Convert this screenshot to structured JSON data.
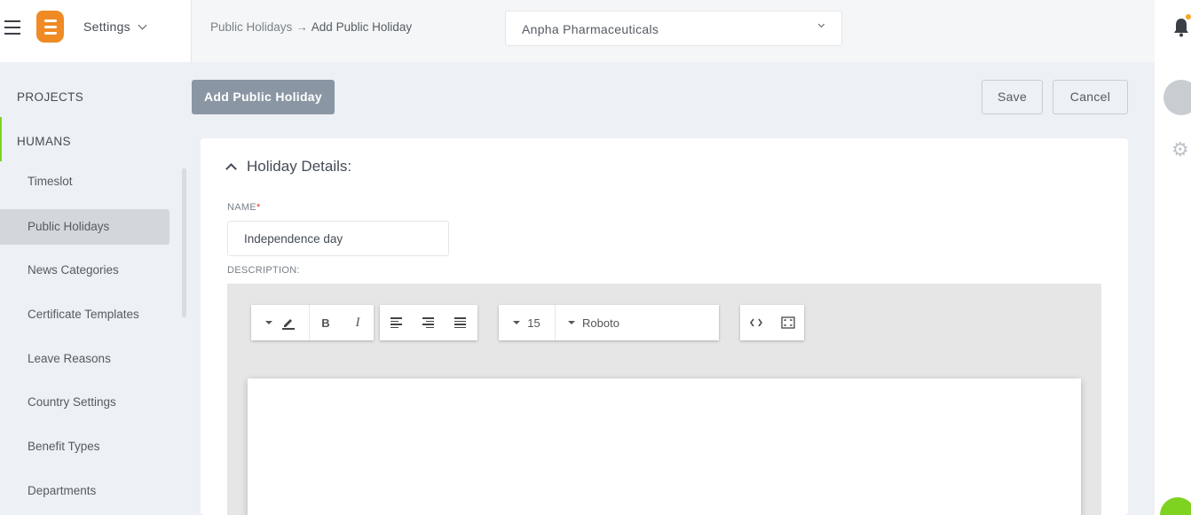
{
  "header": {
    "app_menu_label": "Settings",
    "breadcrumb": {
      "parent": "Public Holidays",
      "separator": "→",
      "current": "Add Public Holiday"
    },
    "organization": "Anpha Pharmaceuticals"
  },
  "sidebar": {
    "sections": [
      "PROJECTS",
      "HUMANS"
    ],
    "items": [
      {
        "label": "Timeslot"
      },
      {
        "label": "Public Holidays"
      },
      {
        "label": "News Categories"
      },
      {
        "label": "Certificate Templates"
      },
      {
        "label": "Leave Reasons"
      },
      {
        "label": "Country Settings"
      },
      {
        "label": "Benefit Types"
      },
      {
        "label": "Departments"
      }
    ],
    "active_item": "Public Holidays",
    "accent_color": "#7ed321"
  },
  "main": {
    "page_label": "Add Public Holiday",
    "save_label": "Save",
    "cancel_label": "Cancel",
    "section_title": "Holiday Details:",
    "name_label": "NAME",
    "name_required_mark": "*",
    "name_value": "Independence day",
    "description_label": "DESCRIPTION:",
    "editor": {
      "font_size": "15",
      "font_family": "Roboto"
    }
  }
}
